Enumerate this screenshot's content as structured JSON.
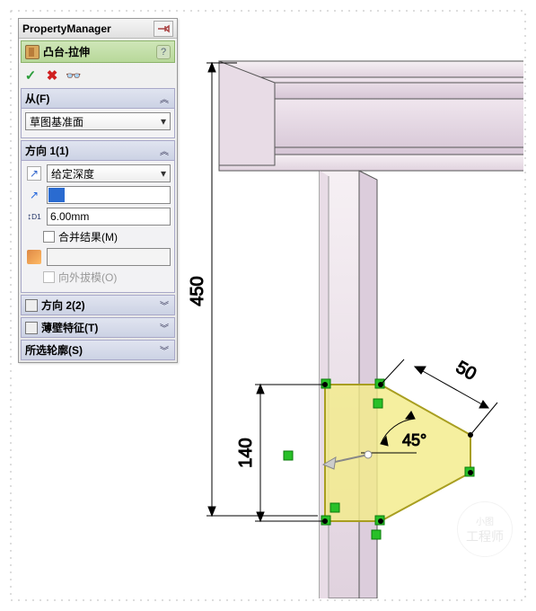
{
  "pm": {
    "title": "PropertyManager",
    "feature_title": "凸台-拉伸",
    "help_glyph": "?",
    "cmd": {
      "ok": "✓",
      "cancel": "✖",
      "preview": "👓"
    }
  },
  "from": {
    "label": "从(F)",
    "plane": "草图基准面"
  },
  "dir1": {
    "label": "方向 1(1)",
    "end_condition": "给定深度",
    "depth_value": "",
    "d1_prefix": "D1",
    "depth_text": "6.00mm",
    "merge_label": "合并结果(M)",
    "draft_label": "向外拔模(O)"
  },
  "dir2": {
    "label": "方向 2(2)"
  },
  "thin": {
    "label": "薄壁特征(T)"
  },
  "contours": {
    "label": "所选轮廓(S)"
  },
  "dims": {
    "d450": "450",
    "d140": "140",
    "d50": "50",
    "a45": "45°"
  },
  "watermark": {
    "line1": "小图",
    "line2": "工程师"
  },
  "colors": {
    "sketch_fill": "#f3eb8a",
    "sketch_stroke": "#a89e20",
    "constraint": "#28c028"
  }
}
